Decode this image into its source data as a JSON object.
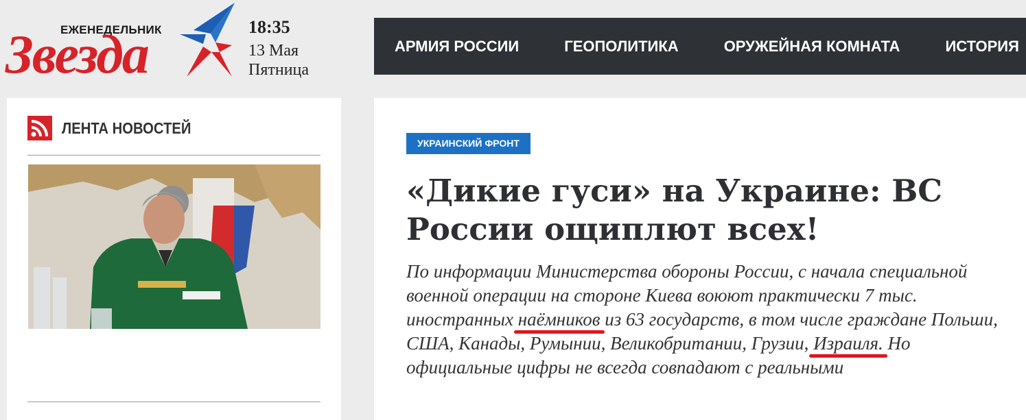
{
  "logo": {
    "weekly": "ЕЖЕНЕДЕЛЬНИК",
    "name": "Звезда"
  },
  "date": {
    "time": "18:35",
    "day": "13 Мая",
    "weekday": "Пятница"
  },
  "nav": {
    "items": [
      "АРМИЯ РОССИИ",
      "ГЕОПОЛИТИКА",
      "ОРУЖЕЙНАЯ КОМНАТА",
      "ИСТОРИЯ"
    ]
  },
  "sidebar": {
    "title": "ЛЕНТА НОВОСТЕЙ",
    "icon": "rss-icon"
  },
  "article": {
    "category": "УКРАИНСКИЙ ФРОНТ",
    "headline": "«Дикие гуси» на Украине: ВС России ощиплют всех!",
    "lead_part1": "По информации Министерства обороны России, с начала специальной военной операции на стороне Киева воюют практически 7 тыс. иностранных ",
    "lead_mark1": "наёмников",
    "lead_part2": " из 63 государств, в том числе граждане Польши, США, Канады, Румынии, Великобритании, Грузии, ",
    "lead_mark2": "Израиля.",
    "lead_part3": " Но официальные цифры не всегда совпадают с реальными"
  },
  "colors": {
    "brand_red": "#d6232a",
    "nav_bg": "#2e3136",
    "category_bg": "#1d71c4",
    "highlight_underline": "#e3141c"
  }
}
